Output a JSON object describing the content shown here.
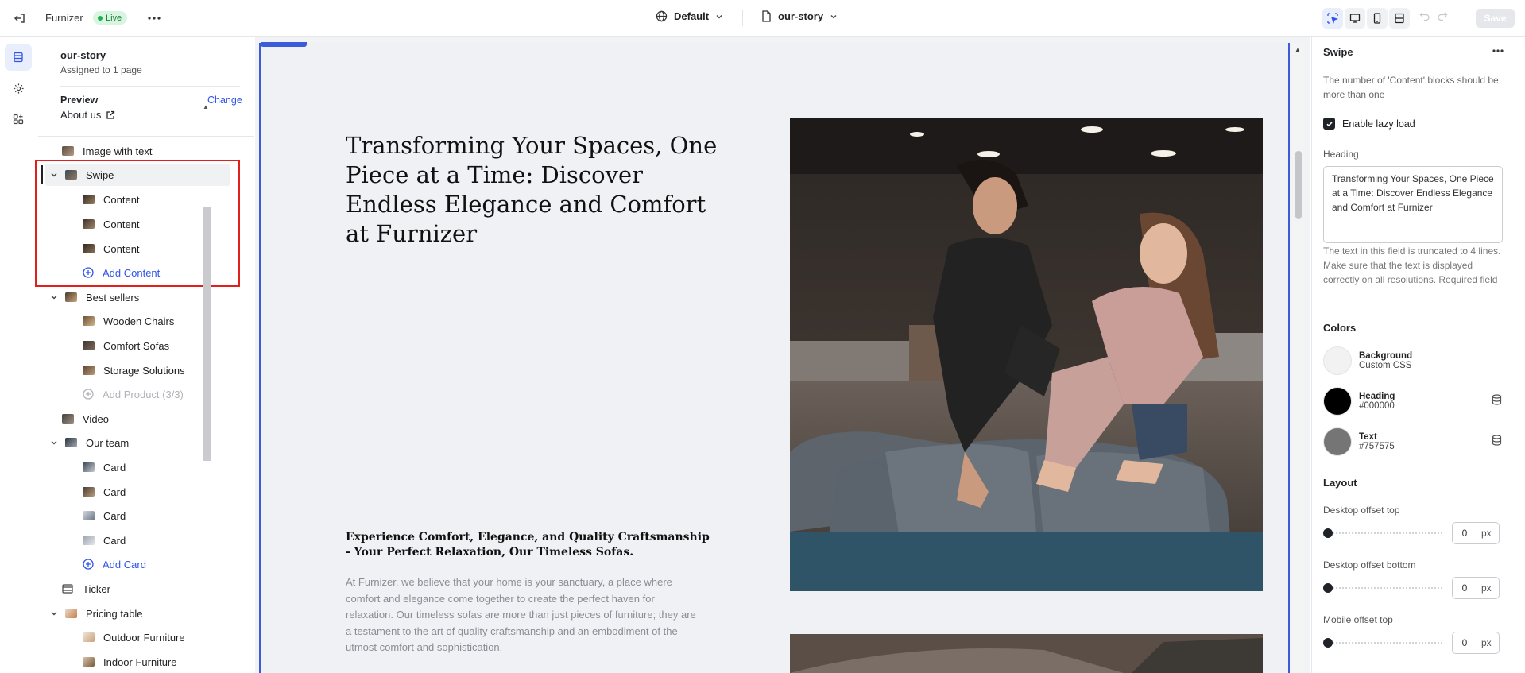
{
  "topbar": {
    "app_name": "Furnizer",
    "status": "Live",
    "locale": "Default",
    "page": "our-story",
    "save_label": "Save"
  },
  "sidebar": {
    "title": "our-story",
    "subtitle": "Assigned to 1 page",
    "preview_label": "Preview",
    "change_label": "Change",
    "preview_page": "About us",
    "tree": {
      "image_with_text": "Image with text",
      "swipe": "Swipe",
      "swipe_children": [
        "Content",
        "Content",
        "Content"
      ],
      "add_content": "Add Content",
      "best_sellers": "Best sellers",
      "best_sellers_children": [
        "Wooden Chairs",
        "Comfort Sofas",
        "Storage Solutions"
      ],
      "add_product": "Add Product (3/3)",
      "video": "Video",
      "our_team": "Our team",
      "our_team_children": [
        "Card",
        "Card",
        "Card",
        "Card"
      ],
      "add_card": "Add Card",
      "ticker": "Ticker",
      "pricing_table": "Pricing table",
      "pricing_children": [
        "Outdoor Furniture",
        "Indoor Furniture"
      ]
    }
  },
  "canvas": {
    "heading": "Transforming Your Spaces, One Piece at a Time: Discover Endless Elegance and Comfort at Furnizer",
    "subheading": "Experience Comfort, Elegance, and Quality Craftsmanship - Your Perfect Relaxation, Our Timeless Sofas.",
    "body": "At Furnizer, we believe that your home is your sanctuary, a place where comfort and elegance come together to create the perfect haven for relaxation. Our timeless sofas are more than just pieces of furniture; they are a testament to the art of quality craftsmanship and an embodiment of the utmost comfort and sophistication."
  },
  "panel": {
    "title": "Swipe",
    "warning": "The number of 'Content' blocks should be more than one",
    "lazy_load_label": "Enable lazy load",
    "lazy_load_checked": true,
    "heading_label": "Heading",
    "heading_value": "Transforming Your Spaces, One Piece at a Time: Discover Endless Elegance and Comfort at Furnizer",
    "heading_help": "The text in this field is truncated to 4 lines. Make sure that the text is displayed correctly on all resolutions. Required field",
    "colors_title": "Colors",
    "colors": [
      {
        "name": "Background",
        "value": "Custom CSS",
        "hex": "#f2f2f2"
      },
      {
        "name": "Heading",
        "value": "#000000",
        "hex": "#000000"
      },
      {
        "name": "Text",
        "value": "#757575",
        "hex": "#757575"
      }
    ],
    "layout_title": "Layout",
    "offsets": [
      {
        "label": "Desktop offset top",
        "value": "0",
        "unit": "px"
      },
      {
        "label": "Desktop offset bottom",
        "value": "0",
        "unit": "px"
      },
      {
        "label": "Mobile offset top",
        "value": "0",
        "unit": "px"
      }
    ]
  },
  "icons": {
    "exit": "exit-icon",
    "more": "more-horizontal-icon",
    "globe": "globe-icon",
    "file": "file-icon",
    "chevron": "chevron-down-icon",
    "select": "select-tool-icon",
    "desktop": "desktop-icon",
    "mobile": "mobile-icon",
    "fullwidth": "fullwidth-icon",
    "undo": "undo-icon",
    "redo": "redo-icon",
    "sections": "sections-icon",
    "settings": "gear-icon",
    "apps": "apps-icon",
    "external": "external-link-icon",
    "database": "database-icon"
  },
  "colors": {
    "accent": "#2f54eb",
    "highlight": "#e0201b",
    "live_bg": "#d7f5df",
    "live_text": "#1a7f37"
  }
}
